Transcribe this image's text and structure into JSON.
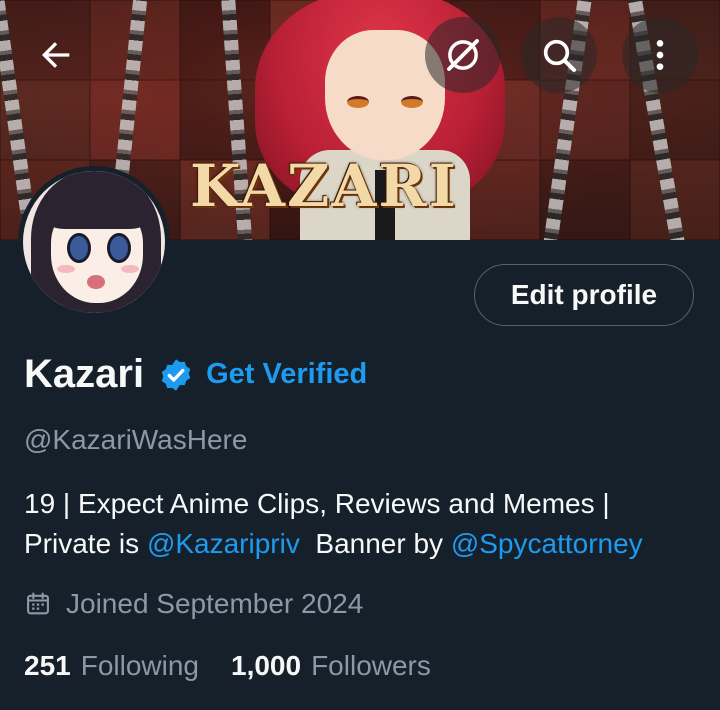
{
  "header": {
    "back_icon": "arrow-left-icon",
    "grok_icon": "grok-icon",
    "search_icon": "search-icon",
    "more_icon": "more-vertical-icon",
    "banner_text": "KAZARI"
  },
  "profile": {
    "name": "Kazari",
    "verified_icon": "verified-badge-icon",
    "get_verified_label": "Get Verified",
    "handle": "@KazariWasHere",
    "edit_label": "Edit profile",
    "bio": {
      "line1": "19 | Expect Anime Clips, Reviews and Memes |",
      "line2_prefix": "Private is ",
      "line2_link1": "@Kazaripriv",
      "line2_middle": "  Banner by ",
      "line2_link2": "@Spycattorney"
    },
    "joined": "Joined September 2024",
    "following_count": "251",
    "following_label": "Following",
    "followers_count": "1,000",
    "followers_label": "Followers"
  },
  "colors": {
    "background": "#15202b",
    "accent": "#1d9bf0",
    "secondary_text": "#8b98a5",
    "primary_text": "#f7f9f9"
  }
}
